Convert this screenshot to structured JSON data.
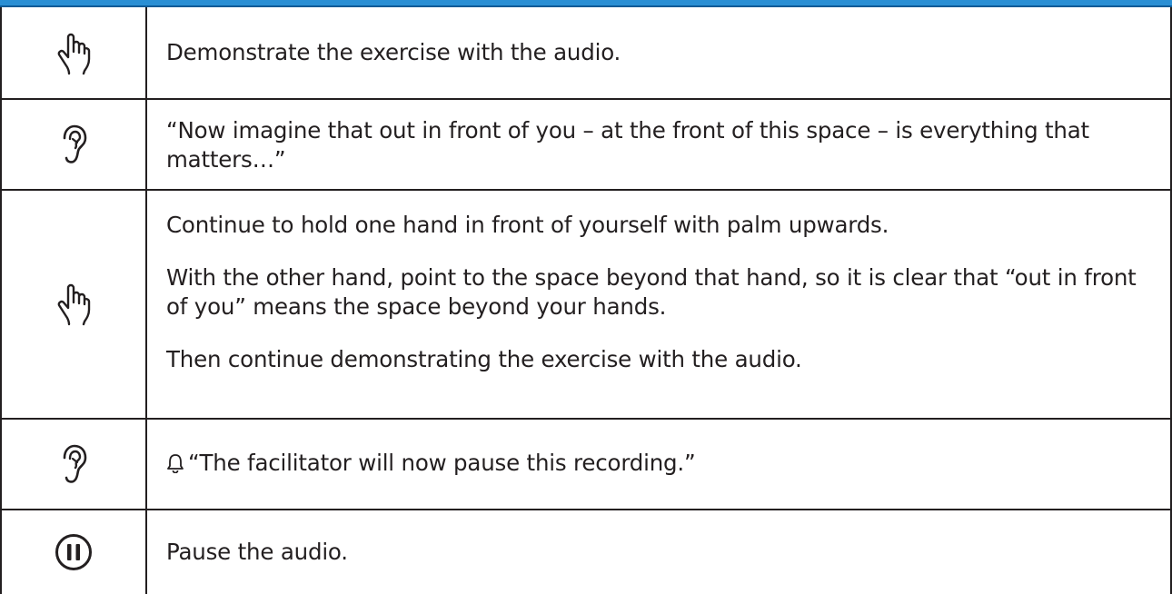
{
  "colors": {
    "header_bar": "#2a8fd4",
    "header_bar_edge": "#0c5a96",
    "rule": "#231f20",
    "text": "#231f20"
  },
  "rows": [
    {
      "icon": "pointing-hand-icon",
      "paragraphs": [
        "Demonstrate the exercise with the audio."
      ]
    },
    {
      "icon": "ear-icon",
      "paragraphs": [
        "“Now imagine that out in front of you – at the front of this space – is everything that matters…”"
      ]
    },
    {
      "icon": "pointing-hand-icon",
      "paragraphs": [
        "Continue to hold one hand in front of yourself with palm upwards.",
        "With the other hand, point to the space beyond that hand, so it is clear that “out in front of you” means the space beyond your hands.",
        "Then continue demonstrating the exercise with the audio."
      ]
    },
    {
      "icon": "ear-icon",
      "inline_icon": "bell-icon",
      "paragraphs": [
        "“The facilitator will now pause this recording.”"
      ]
    },
    {
      "icon": "pause-icon",
      "paragraphs": [
        "Pause the audio."
      ]
    }
  ]
}
